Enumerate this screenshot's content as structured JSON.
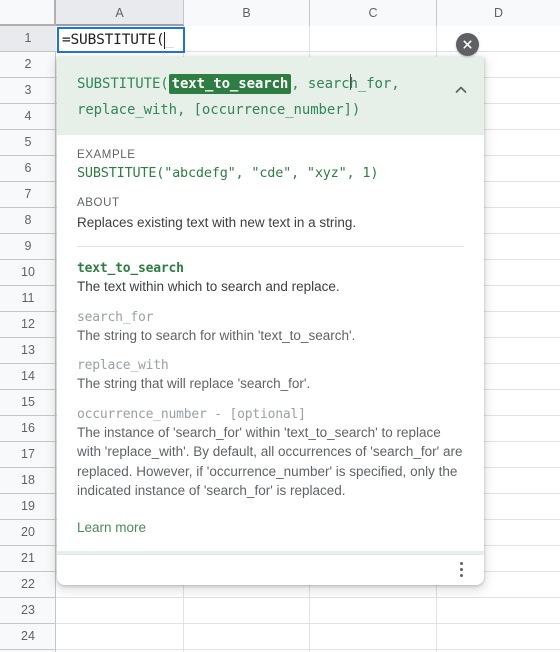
{
  "spreadsheet": {
    "columns": [
      "A",
      "B",
      "C",
      "D"
    ],
    "selected_column": "A",
    "rows": [
      "1",
      "2",
      "3",
      "4",
      "5",
      "6",
      "7",
      "8",
      "9",
      "10",
      "11",
      "12",
      "13",
      "14",
      "15",
      "16",
      "17",
      "18",
      "19",
      "20",
      "21",
      "22",
      "23",
      "24"
    ],
    "selected_row": "1",
    "active_cell": {
      "reference": "A1",
      "value": "=SUBSTITUTE("
    }
  },
  "formula_help": {
    "function_name": "SUBSTITUTE",
    "signature": {
      "prefix": "SUBSTITUTE(",
      "active_argument": "text_to_search",
      "remaining": ", search_for, replace_with, [occurrence_number])",
      "segment_after_active": ", ",
      "arg_search_for": "search_for",
      "arg_separator": ", ",
      "line2": "replace_with, [occurrence_number])"
    },
    "collapse_icon": "chevron-up-icon",
    "close_icon": "close-icon",
    "kebab_icon": "more-options-icon",
    "example_label": "EXAMPLE",
    "example_code": "SUBSTITUTE(\"abcdefg\", \"cde\", \"xyz\", 1)",
    "about_label": "ABOUT",
    "about_text": "Replaces existing text with new text in a string.",
    "parameters": [
      {
        "name": "text_to_search",
        "description": "The text within which to search and replace.",
        "active": true
      },
      {
        "name": "search_for",
        "description": "The string to search for within 'text_to_search'.",
        "active": false
      },
      {
        "name": "replace_with",
        "description": "The string that will replace 'search_for'.",
        "active": false
      },
      {
        "name": "occurrence_number - [optional]",
        "description": "The instance of 'search_for' within 'text_to_search' to replace with 'replace_with'. By default, all occurrences of 'search_for' are replaced. However, if 'occurrence_number' is specified, only the indicated instance of 'search_for' is replaced.",
        "active": false
      }
    ],
    "learn_more_label": "Learn more"
  },
  "colors": {
    "header_bg": "#e6f0e8",
    "active_arg_bg": "#2e7d43",
    "formula_green": "#34855a",
    "link_green": "#4a8a5e",
    "editor_border": "#1a73e8",
    "close_bg": "#5f6063"
  }
}
